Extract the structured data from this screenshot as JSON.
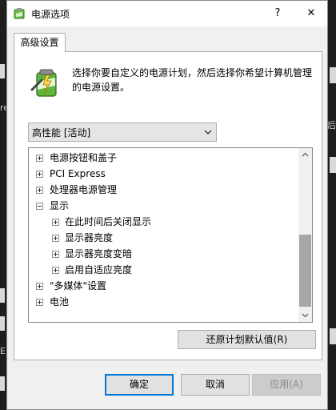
{
  "window": {
    "title": "电源选项",
    "help_glyph": "?",
    "close_glyph": "✕"
  },
  "tab": {
    "label": "高级设置"
  },
  "description": {
    "line1": "选择你要自定义的电源计划，然后选择你希望计算机管理",
    "line2": "的电源设置。"
  },
  "plan": {
    "selected": "高性能 [活动]"
  },
  "tree": {
    "items": [
      {
        "label": "电源按钮和盖子",
        "expander": "+"
      },
      {
        "label": "PCI Express",
        "expander": "+"
      },
      {
        "label": "处理器电源管理",
        "expander": "+"
      },
      {
        "label": "显示",
        "expander": "-"
      },
      {
        "label": "在此时间后关闭显示",
        "expander": "+"
      },
      {
        "label": "显示器亮度",
        "expander": "+"
      },
      {
        "label": "显示器亮度变暗",
        "expander": "+"
      },
      {
        "label": "启用自适应亮度",
        "expander": "+"
      },
      {
        "label": "\"多媒体\"设置",
        "expander": "+"
      },
      {
        "label": "电池",
        "expander": "+"
      }
    ],
    "scroll_position": 0.58
  },
  "buttons": {
    "restore": "还原计划默认值(R)",
    "ok": "确定",
    "cancel": "取消",
    "apply": "应用(A)"
  },
  "background": {
    "left_glyph_1": "re",
    "left_glyph_2": "E",
    "right_glyph": "后"
  },
  "colors": {
    "focus_border": "#0078d7",
    "scroll_thumb": "#a6a6a6",
    "battery_green": "#5fb43a"
  }
}
